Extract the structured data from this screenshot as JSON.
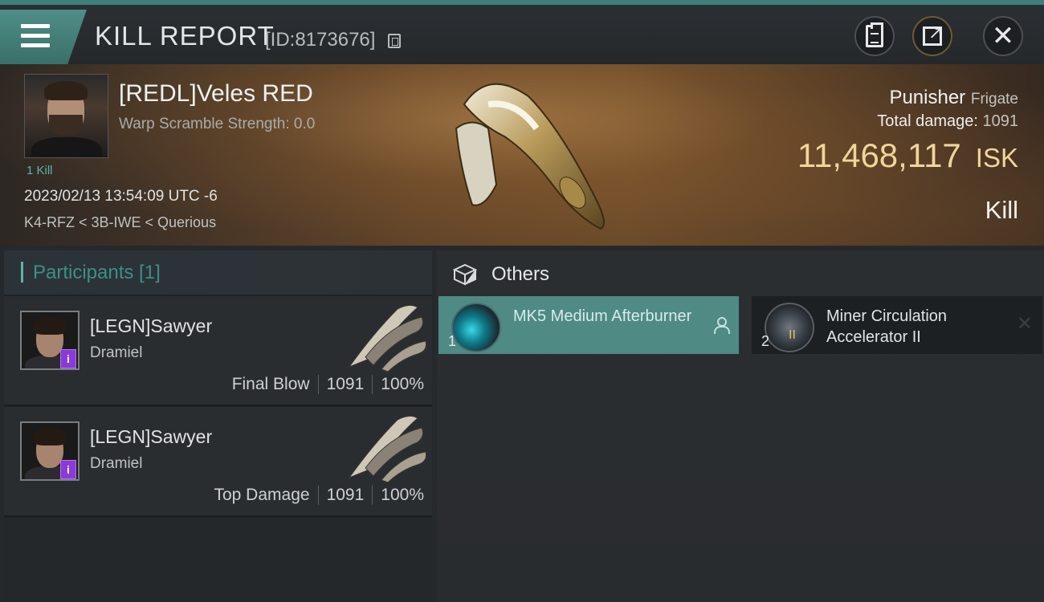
{
  "header": {
    "title": "KILL REPORT",
    "report_id": "[ID:8173676]",
    "icons": [
      "menu-icon",
      "copy-icon",
      "clipboard-icon",
      "share-icon",
      "close-icon"
    ]
  },
  "victim": {
    "name": "[REDL]Veles RED",
    "warp_scramble": "Warp Scramble Strength: 0.0",
    "kills": "1 Kill",
    "datetime": "2023/02/13 13:54:09 UTC -6",
    "location": "K4-RFZ < 3B-IWE < Querious",
    "ship_name": "Punisher",
    "ship_class": "Frigate",
    "damage_label": "Total damage:",
    "damage_value": "1091",
    "isk_value": "11,468,117",
    "isk_unit": "ISK",
    "result": "Kill"
  },
  "participants": {
    "title": "Participants [1]",
    "items": [
      {
        "name": "[LEGN]Sawyer",
        "ship": "Dramiel",
        "tag": "Final Blow",
        "damage": "1091",
        "percent": "100%",
        "badge": "i"
      },
      {
        "name": "[LEGN]Sawyer",
        "ship": "Dramiel",
        "tag": "Top Damage",
        "damage": "1091",
        "percent": "100%",
        "badge": "i"
      }
    ]
  },
  "others": {
    "title": "Others",
    "items": [
      {
        "index": "1",
        "name": "MK5 Medium Afterburner"
      },
      {
        "index": "2",
        "name": "Miner Circulation Accelerator II",
        "level": "II"
      }
    ]
  },
  "colors": {
    "accent": "#4f8a84",
    "isk": "#f0d59a",
    "participants_label": "#3d8f87",
    "badge": "#8a3ad6"
  }
}
